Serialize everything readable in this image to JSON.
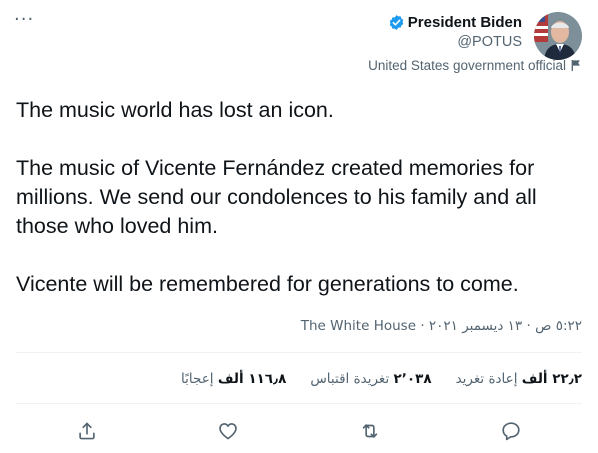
{
  "header": {
    "more_glyph": "···",
    "display_name": "President Biden",
    "handle": "@POTUS",
    "affiliation": "United States government official"
  },
  "tweet": {
    "paragraphs": [
      "The music world has lost an icon.",
      "The music of Vicente Fernández created memories for millions. We send our condolences to his family and all those who loved him.",
      "Vicente will be remembered for generations to come."
    ],
    "time": "٥:٢٢ ص",
    "date": "١٣ ديسمبر ٢٠٢١",
    "separator": "·",
    "source": "The White House"
  },
  "stats": {
    "retweets": {
      "value": "٢٢٫٢ ألف",
      "label": "إعادة تغريد"
    },
    "quotes": {
      "value": "٢٬٠٣٨",
      "label": "تغريدة اقتباس"
    },
    "likes": {
      "value": "١١٦٫٨ ألف",
      "label": "إعجابًا"
    }
  },
  "actions": {
    "icons": [
      "reply-icon",
      "retweet-icon",
      "like-icon",
      "share-icon"
    ]
  },
  "colors": {
    "text": "#0f1419",
    "secondary": "#536471",
    "verified": "#1d9bf0",
    "divider": "#eff3f4"
  }
}
